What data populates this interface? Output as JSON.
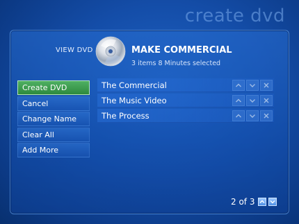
{
  "page": {
    "title": "create dvd"
  },
  "header": {
    "view_label": "VIEW DVD",
    "title": "MAKE COMMERCIAL",
    "subtitle": "3 items  8 Minutes selected"
  },
  "menu": {
    "items": [
      {
        "label": "Create DVD",
        "active": true
      },
      {
        "label": "Cancel"
      },
      {
        "label": "Change Name"
      },
      {
        "label": "Clear All"
      },
      {
        "label": "Add More"
      }
    ]
  },
  "list": {
    "items": [
      {
        "label": "The Commercial"
      },
      {
        "label": "The Music Video"
      },
      {
        "label": "The Process"
      }
    ]
  },
  "pager": {
    "text": "2 of 3"
  },
  "colors": {
    "accent_active": "#3f9e50",
    "background": "#144da8"
  },
  "icons": {
    "up": "arrow-up-icon",
    "down": "arrow-down-icon",
    "remove": "x-icon",
    "disc": "dvd-disc-icon"
  }
}
